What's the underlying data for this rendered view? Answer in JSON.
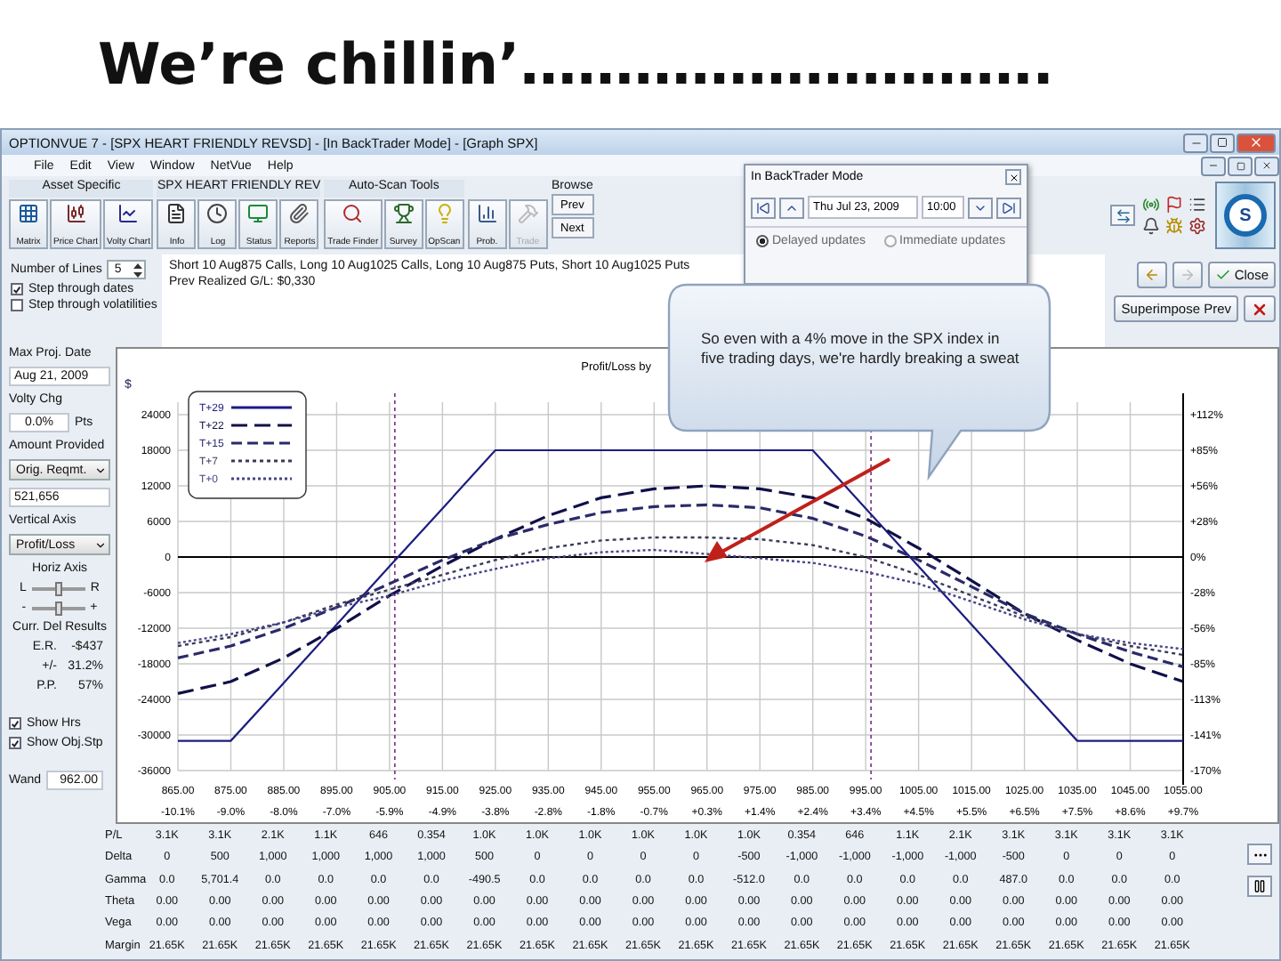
{
  "slide_title": "We’re chillin’……………………….",
  "window": {
    "title": "OPTIONVUE 7 - [SPX HEART FRIENDLY REVSD] - [In BackTrader Mode] - [Graph SPX]"
  },
  "menu": [
    "File",
    "Edit",
    "View",
    "Window",
    "NetVue",
    "Help"
  ],
  "toolbar": {
    "groups": [
      {
        "label": "Asset Specific",
        "buttons": [
          {
            "label": "Matrix",
            "disabled": false
          },
          {
            "label": "Price Chart",
            "disabled": false
          },
          {
            "label": "Volty Chart",
            "disabled": false
          }
        ]
      },
      {
        "label": "SPX HEART FRIENDLY REV",
        "buttons": [
          {
            "label": "Info",
            "disabled": false
          },
          {
            "label": "Log",
            "disabled": false
          },
          {
            "label": "Status",
            "disabled": false
          },
          {
            "label": "Reports",
            "disabled": false
          }
        ]
      },
      {
        "label": "Auto-Scan Tools",
        "buttons": [
          {
            "label": "Trade Finder",
            "disabled": false
          },
          {
            "label": "Survey",
            "disabled": false
          },
          {
            "label": "OpScan",
            "disabled": false
          }
        ]
      },
      {
        "buttons": [
          {
            "label": "Prob.",
            "disabled": false
          },
          {
            "label": "Trade",
            "disabled": true
          }
        ]
      }
    ],
    "browse_label": "Browse",
    "browse_buttons": [
      "Prev",
      "Next"
    ],
    "logo_text": "S"
  },
  "backtrader": {
    "title": "In BackTrader Mode",
    "date": "Thu Jul 23, 2009",
    "time": "10:00",
    "radios": [
      {
        "label": "Delayed updates",
        "selected": true
      },
      {
        "label": "Immediate updates",
        "selected": false
      }
    ]
  },
  "top_controls": {
    "lines_label": "Number of Lines",
    "lines_value": "5",
    "checkboxes": [
      {
        "label": "Step through dates",
        "checked": true
      },
      {
        "label": "Step through volatilities",
        "checked": false
      }
    ]
  },
  "strategy": {
    "position": "Short 10 Aug875 Calls, Long 10 Aug1025 Calls, Long 10 Aug875 Puts, Short 10 Aug1025 Puts",
    "realized": "Prev Realized G/L: $0,330"
  },
  "right_buttons": {
    "close": "Close",
    "superimpose": "Superimpose Prev",
    "forward_disabled": true
  },
  "left_panel": {
    "max_date_label": "Max Proj. Date",
    "max_date": "Aug 21, 2009",
    "volty_label": "Volty Chg",
    "volty_value": "0.0%",
    "volty_unit": "Pts",
    "amount_label": "Amount Provided",
    "amount_select": "Orig. Reqmt.",
    "amount_value": "521,656",
    "vaxis_label": "Vertical Axis",
    "vaxis_select": "Profit/Loss",
    "haxis_label": "Horiz Axis",
    "haxis_sliders": [
      {
        "left": "L",
        "right": "R",
        "level": 0.5
      },
      {
        "left": "-",
        "right": "+",
        "level": 0.5
      }
    ],
    "results_label": "Curr. Del Results",
    "results": [
      {
        "label": "E.R.",
        "value": "-$437"
      },
      {
        "label": "+/-",
        "value": "31.2%"
      },
      {
        "label": "P.P.",
        "value": "57%"
      }
    ],
    "show_checks": [
      {
        "label": "Show Hrs",
        "checked": true
      },
      {
        "label": "Show Obj.Stp",
        "checked": true
      }
    ],
    "wand_label": "Wand",
    "wand_value": "962.00"
  },
  "chart": {
    "right_axis": [
      "+112%",
      "+85%",
      "+56%",
      "+28%",
      "0%",
      "-28%",
      "-56%",
      "-85%",
      "-113%",
      "-141%",
      "-170%"
    ],
    "x_percent": [
      "-10.1%",
      "-9.0%",
      "-8.0%",
      "-7.0%",
      "-5.9%",
      "-4.9%",
      "-3.8%",
      "-2.8%",
      "-1.8%",
      "-0.7%",
      "+0.3%",
      "+1.4%",
      "+2.4%",
      "+3.4%",
      "+4.5%",
      "+5.5%",
      "+6.5%",
      "+7.5%",
      "+8.6%",
      "+9.7%"
    ],
    "chart_data": {
      "type": "line",
      "title": "Profit/Loss by",
      "ylabel": "$",
      "x": [
        865,
        875,
        885,
        895,
        905,
        915,
        925,
        935,
        945,
        955,
        965,
        975,
        985,
        995,
        1005,
        1015,
        1025,
        1035,
        1045,
        1055
      ],
      "xticks": [
        {
          "value": 865,
          "label": "865.00"
        },
        {
          "value": 875,
          "label": "875.00"
        },
        {
          "value": 885,
          "label": "885.00"
        },
        {
          "value": 895,
          "label": "895.00"
        },
        {
          "value": 905,
          "label": "905.00"
        },
        {
          "value": 915,
          "label": "915.00"
        },
        {
          "value": 925,
          "label": "925.00"
        },
        {
          "value": 935,
          "label": "935.00"
        },
        {
          "value": 945,
          "label": "945.00"
        },
        {
          "value": 955,
          "label": "955.00"
        },
        {
          "value": 965,
          "label": "965.00"
        },
        {
          "value": 975,
          "label": "975.00"
        },
        {
          "value": 985,
          "label": "985.00"
        },
        {
          "value": 995,
          "label": "995.00"
        },
        {
          "value": 1005,
          "label": "1005.00"
        },
        {
          "value": 1015,
          "label": "1015.00"
        },
        {
          "value": 1025,
          "label": "1025.00"
        },
        {
          "value": 1035,
          "label": "1035.00"
        },
        {
          "value": 1045,
          "label": "1045.00"
        },
        {
          "value": 1055,
          "label": "1055.00"
        }
      ],
      "yticks": [
        24000,
        18000,
        12000,
        6000,
        0,
        -6000,
        -12000,
        -18000,
        -24000,
        -30000,
        -36000
      ],
      "ylim": [
        -36000,
        24000
      ],
      "xlim": [
        865,
        1055
      ],
      "series": [
        {
          "name": "T+29",
          "color": "#1c1c80",
          "line_style": "solid",
          "values": [
            -31000,
            -31000,
            -21200,
            -11400,
            -1600,
            8200,
            18000,
            18000,
            18000,
            18000,
            18000,
            18000,
            18000,
            8200,
            -1600,
            -11400,
            -21200,
            -31000,
            -31000,
            -31000
          ]
        },
        {
          "name": "T+22",
          "color": "#101048",
          "line_style": "dashed",
          "values": [
            -23000,
            -21000,
            -17000,
            -12000,
            -6500,
            -1500,
            3000,
            7000,
            10000,
            11500,
            12000,
            11500,
            10000,
            6500,
            1500,
            -4000,
            -9500,
            -14000,
            -18000,
            -21000
          ]
        },
        {
          "name": "T+15",
          "color": "#2a2a6a",
          "line_style": "dashed",
          "values": [
            -17000,
            -15000,
            -12000,
            -8500,
            -4500,
            -500,
            3000,
            5500,
            7500,
            8500,
            8800,
            8300,
            6500,
            3500,
            -500,
            -5000,
            -9500,
            -13000,
            -16000,
            -18500
          ]
        },
        {
          "name": "T+7",
          "color": "#3a3a58",
          "line_style": "dotted",
          "values": [
            -15000,
            -13500,
            -11000,
            -8000,
            -5500,
            -3000,
            -500,
            1500,
            2800,
            3300,
            3300,
            3000,
            2000,
            0,
            -3000,
            -6500,
            -10000,
            -13000,
            -15000,
            -16500
          ]
        },
        {
          "name": "T+0",
          "color": "#444488",
          "line_style": "dotted",
          "values": [
            -14500,
            -13000,
            -11000,
            -8500,
            -6500,
            -4000,
            -2000,
            -200,
            800,
            1200,
            500,
            -200,
            -1000,
            -2500,
            -4500,
            -7500,
            -10500,
            -13000,
            -14500,
            -15500
          ]
        }
      ],
      "grid": true,
      "legend": true,
      "ref_lines": [
        {
          "axis": "x",
          "value": 906
        },
        {
          "axis": "x",
          "value": 996
        }
      ]
    }
  },
  "callout": {
    "text": "So even with a 4% move in the SPX index in five trading days, we're hardly breaking a sweat"
  },
  "greeks": [
    {
      "label": "P/L",
      "values": [
        "3.1K",
        "3.1K",
        "2.1K",
        "1.1K",
        "646",
        "0.354",
        "1.0K",
        "1.0K",
        "1.0K",
        "1.0K",
        "1.0K",
        "1.0K",
        "0.354",
        "646",
        "1.1K",
        "2.1K",
        "3.1K",
        "3.1K",
        "3.1K",
        "3.1K"
      ]
    },
    {
      "label": "Delta",
      "values": [
        "0",
        "500",
        "1,000",
        "1,000",
        "1,000",
        "1,000",
        "500",
        "0",
        "0",
        "0",
        "0",
        "-500",
        "-1,000",
        "-1,000",
        "-1,000",
        "-1,000",
        "-500",
        "0",
        "0",
        "0"
      ]
    },
    {
      "label": "Gamma",
      "values": [
        "0.0",
        "5,701.4",
        "0.0",
        "0.0",
        "0.0",
        "0.0",
        "-490.5",
        "0.0",
        "0.0",
        "0.0",
        "0.0",
        "-512.0",
        "0.0",
        "0.0",
        "0.0",
        "0.0",
        "487.0",
        "0.0",
        "0.0",
        "0.0"
      ]
    },
    {
      "label": "Theta",
      "values": [
        "0.00",
        "0.00",
        "0.00",
        "0.00",
        "0.00",
        "0.00",
        "0.00",
        "0.00",
        "0.00",
        "0.00",
        "0.00",
        "0.00",
        "0.00",
        "0.00",
        "0.00",
        "0.00",
        "0.00",
        "0.00",
        "0.00",
        "0.00"
      ]
    },
    {
      "label": "Vega",
      "values": [
        "0.00",
        "0.00",
        "0.00",
        "0.00",
        "0.00",
        "0.00",
        "0.00",
        "0.00",
        "0.00",
        "0.00",
        "0.00",
        "0.00",
        "0.00",
        "0.00",
        "0.00",
        "0.00",
        "0.00",
        "0.00",
        "0.00",
        "0.00"
      ]
    },
    {
      "label": "Margin",
      "values": [
        "21.65K",
        "21.65K",
        "21.65K",
        "21.65K",
        "21.65K",
        "21.65K",
        "21.65K",
        "21.65K",
        "21.65K",
        "21.65K",
        "21.65K",
        "21.65K",
        "21.65K",
        "21.65K",
        "21.65K",
        "21.65K",
        "21.65K",
        "21.65K",
        "21.65K",
        "21.65K"
      ]
    }
  ]
}
